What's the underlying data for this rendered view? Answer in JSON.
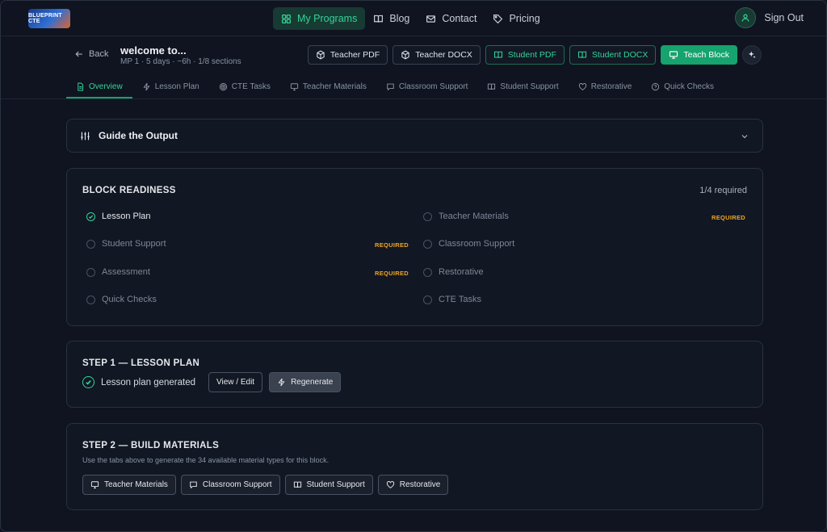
{
  "nav": {
    "logo_text": "BLUEPRINT CTE",
    "items": [
      {
        "label": "My Programs",
        "icon": "grid-icon",
        "active": true
      },
      {
        "label": "Blog",
        "icon": "book-icon",
        "active": false
      },
      {
        "label": "Contact",
        "icon": "mail-icon",
        "active": false
      },
      {
        "label": "Pricing",
        "icon": "tag-icon",
        "active": false
      }
    ],
    "signout_label": "Sign Out"
  },
  "header": {
    "back_label": "Back",
    "title": "welcome to...",
    "subtitle": "MP 1 · 5 days · ~6h · 1/8 sections",
    "actions": [
      {
        "label": "Teacher PDF",
        "style": "outline"
      },
      {
        "label": "Teacher DOCX",
        "style": "outline"
      },
      {
        "label": "Student PDF",
        "style": "green-outline"
      },
      {
        "label": "Student DOCX",
        "style": "green-outline"
      },
      {
        "label": "Teach Block",
        "style": "solid-green"
      }
    ]
  },
  "tabs": [
    {
      "label": "Overview",
      "active": true
    },
    {
      "label": "Lesson Plan"
    },
    {
      "label": "CTE Tasks"
    },
    {
      "label": "Teacher Materials"
    },
    {
      "label": "Classroom Support"
    },
    {
      "label": "Student Support"
    },
    {
      "label": "Restorative"
    },
    {
      "label": "Quick Checks"
    }
  ],
  "guide": {
    "title": "Guide the Output"
  },
  "readiness": {
    "heading": "BLOCK READINESS",
    "count": "1/4 required",
    "required_label": "REQUIRED",
    "left": [
      {
        "label": "Lesson Plan",
        "done": true,
        "required": false
      },
      {
        "label": "Student Support",
        "done": false,
        "required": true
      },
      {
        "label": "Assessment",
        "done": false,
        "required": true
      },
      {
        "label": "Quick Checks",
        "done": false,
        "required": false
      }
    ],
    "right": [
      {
        "label": "Teacher Materials",
        "done": false,
        "required": true
      },
      {
        "label": "Classroom Support",
        "done": false,
        "required": false
      },
      {
        "label": "Restorative",
        "done": false,
        "required": false
      },
      {
        "label": "CTE Tasks",
        "done": false,
        "required": false
      }
    ]
  },
  "step1": {
    "heading": "STEP 1 — LESSON PLAN",
    "status": "Lesson plan generated",
    "view_edit_label": "View / Edit",
    "regenerate_label": "Regenerate"
  },
  "step2": {
    "heading": "STEP 2 — BUILD MATERIALS",
    "description": "Use the tabs above to generate the 34 available material types for this block.",
    "buttons": [
      {
        "label": "Teacher Materials"
      },
      {
        "label": "Classroom Support"
      },
      {
        "label": "Student Support"
      },
      {
        "label": "Restorative"
      }
    ]
  },
  "colors": {
    "accent": "#16a36e",
    "accent_text": "#34d399",
    "required": "#f0a623",
    "background": "#0f1420"
  }
}
